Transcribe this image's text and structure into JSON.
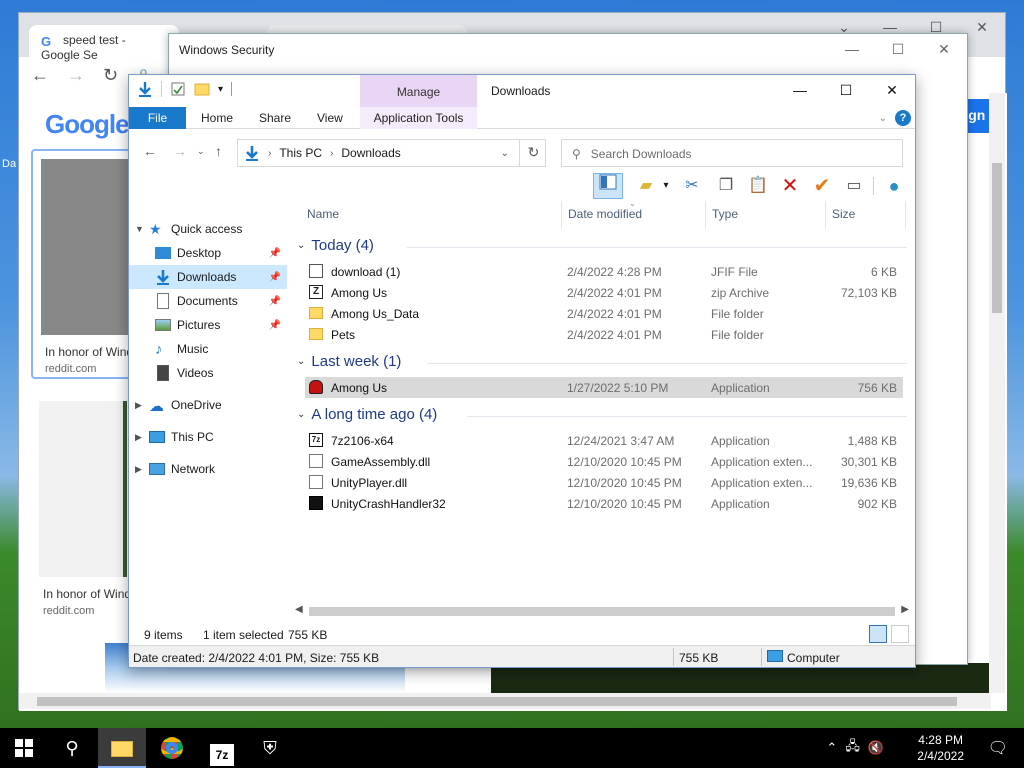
{
  "chrome": {
    "tab1_title": "speed test - Google Se",
    "tab2_title": "",
    "omnibox_text": "",
    "card1_caption": "In honor of Wind",
    "card1_source": "reddit.com",
    "card2_caption": "In honor of Wind",
    "card2_source": "reddit.com",
    "sign_in_label": "Sign i",
    "desktop_label": "Da"
  },
  "security_window": {
    "title": "Windows Security"
  },
  "explorer": {
    "title": "Downloads",
    "manage_label": "Manage",
    "ribbon_tabs": [
      "File",
      "Home",
      "Share",
      "View",
      "Application Tools"
    ],
    "breadcrumb": [
      "This PC",
      "Downloads"
    ],
    "search_placeholder": "Search Downloads",
    "columns": [
      "Name",
      "Date modified",
      "Type",
      "Size"
    ],
    "nav": {
      "quick_access": "Quick access",
      "desktop": "Desktop",
      "downloads": "Downloads",
      "documents": "Documents",
      "pictures": "Pictures",
      "music": "Music",
      "videos": "Videos",
      "onedrive": "OneDrive",
      "this_pc": "This PC",
      "network": "Network"
    },
    "groups": [
      {
        "label": "Today (4)"
      },
      {
        "label": "Last week (1)"
      },
      {
        "label": "A long time ago (4)"
      }
    ],
    "files": [
      {
        "name": "download (1)",
        "date": "2/4/2022 4:28 PM",
        "type": "JFIF File",
        "size": "6 KB"
      },
      {
        "name": "Among Us",
        "date": "2/4/2022 4:01 PM",
        "type": "zip Archive",
        "size": "72,103 KB"
      },
      {
        "name": "Among Us_Data",
        "date": "2/4/2022 4:01 PM",
        "type": "File folder",
        "size": ""
      },
      {
        "name": "Pets",
        "date": "2/4/2022 4:01 PM",
        "type": "File folder",
        "size": ""
      },
      {
        "name": "Among Us",
        "date": "1/27/2022 5:10 PM",
        "type": "Application",
        "size": "756 KB"
      },
      {
        "name": "7z2106-x64",
        "date": "12/24/2021 3:47 AM",
        "type": "Application",
        "size": "1,488 KB"
      },
      {
        "name": "GameAssembly.dll",
        "date": "12/10/2020 10:45 PM",
        "type": "Application exten...",
        "size": "30,301 KB"
      },
      {
        "name": "UnityPlayer.dll",
        "date": "12/10/2020 10:45 PM",
        "type": "Application exten...",
        "size": "19,636 KB"
      },
      {
        "name": "UnityCrashHandler32",
        "date": "12/10/2020 10:45 PM",
        "type": "Application",
        "size": "902 KB"
      }
    ],
    "status": {
      "item_count": "9 items",
      "selected": "1 item selected",
      "selected_size": "755 KB",
      "details": "Date created: 2/4/2022 4:01 PM, Size: 755 KB",
      "size2": "755 KB",
      "location": "Computer"
    }
  },
  "taskbar": {
    "app_7z_label": "7z",
    "time": "4:28 PM",
    "date": "2/4/2022"
  },
  "colors": {
    "accent": "#1979ca",
    "manage": "#e9d5f4",
    "selection": "#cce8ff"
  }
}
